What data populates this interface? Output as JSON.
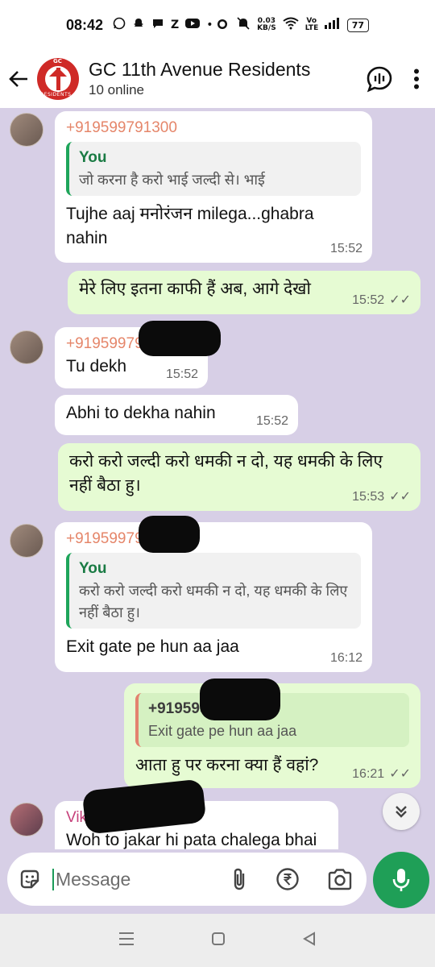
{
  "status_bar": {
    "time": "08:42",
    "left_glyphs": [
      "whatsapp-icon",
      "snapchat-icon",
      "chat-icon",
      "Z",
      "youtube-icon",
      "•"
    ],
    "net_speed_value": "0.03",
    "net_speed_unit": "KB/S",
    "volte_label": "Vo LTE",
    "battery": "77"
  },
  "header": {
    "title": "GC 11th Avenue Residents",
    "subtitle": "10 online",
    "avatar_text": "RESIDENTS",
    "avatar_top_text": "GC"
  },
  "messages": [
    {
      "sender": "+919599791300",
      "quote_author": "You",
      "quote_text": "जो करना है करो भाई जल्दी से। भाई",
      "text": "Tujhe aaj मनोरंजन  milega...ghabra nahin",
      "time": "15:52"
    },
    {
      "text": "मेरे लिए इतना काफी हैं अब, आगे देखो",
      "time": "15:52"
    },
    {
      "sender": "+919599791300",
      "text": "Tu dekh",
      "time": "15:52"
    },
    {
      "text": "Abhi to dekha nahin",
      "time": "15:52"
    },
    {
      "text": "करो करो जल्दी करो धमकी न दो, यह धमकी के लिए नहीं बैठा हु।",
      "time": "15:53"
    },
    {
      "sender": "+919599791300",
      "quote_author": "You",
      "quote_text": "करो करो जल्दी करो धमकी न दो, यह धमकी के लिए नहीं बैठा हु।",
      "text": "Exit gate pe hun aa jaa",
      "time": "16:12"
    },
    {
      "quote_author": "+919599791300",
      "quote_text": "Exit gate pe hun aa jaa",
      "text": "आता हु पर करना क्या हैं वहां?",
      "time": "16:21"
    },
    {
      "sender": "Vikram Singh Gc11",
      "text": "Woh to jakar hi pata chalega bhai"
    }
  ],
  "composer": {
    "placeholder": "Message"
  },
  "colors": {
    "chat_bg": "#d7cfe6",
    "incoming_bubble": "#ffffff",
    "outgoing_bubble": "#e6fbd3",
    "accent_green": "#1f9f57",
    "sender_color": "#e5866a"
  }
}
